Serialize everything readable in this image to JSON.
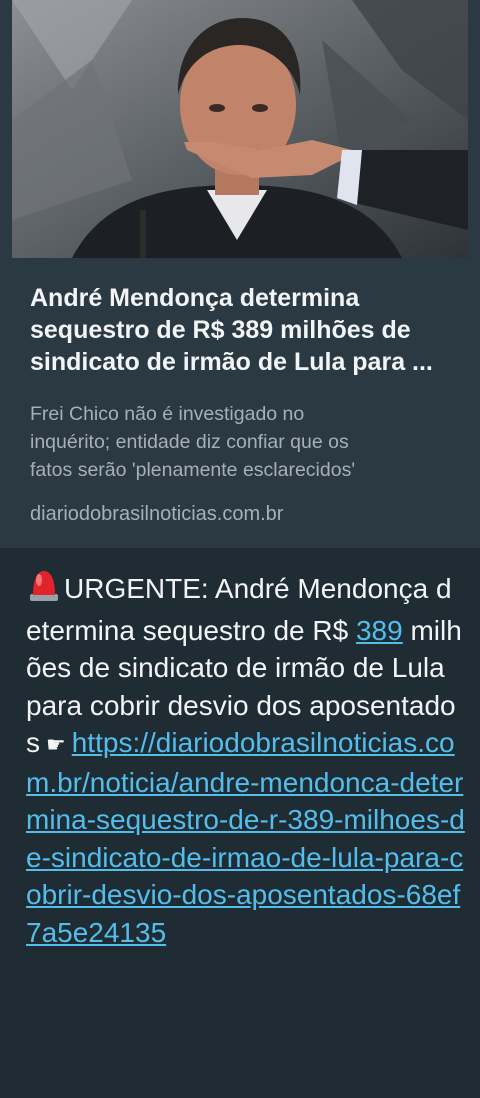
{
  "link_preview": {
    "image_alt": "thumbnail-photo",
    "title_lines": [
      "André Mendonça determina",
      "sequestro de R$ 389 milhões de",
      "sindicato de irmão de Lula para ..."
    ],
    "description_lines": [
      "Frei Chico não é investigado no",
      "inquérito; entidade diz confiar que os",
      "fatos serão 'plenamente esclarecidos'"
    ],
    "domain": "diariodobrasilnoticias.com.br"
  },
  "message": {
    "siren_icon": "police-siren-emoji",
    "text_a": "URGENTE: André Mendonça determina sequestro de R$ ",
    "number": "389",
    "text_b": " milhões de sindicato de irmão de Lula para cobrir desvio dos aposentados",
    "pointer_icon": "pointing-hand-emoji",
    "pointer_glyph": "☛",
    "link": "https://diariodobrasilnoticias.com.br/noticia/andre-mendonca-determina-sequestro-de-r-389-milhoes-de-sindicato-de-irmao-de-lula-para-cobrir-desvio-dos-aposentados-68ef7a5e24135"
  },
  "colors": {
    "bubble": "#1f2c34",
    "preview_bg": "#2a3942",
    "link": "#53bdeb",
    "text": "#f2f4f5",
    "muted": "#a7b0b5"
  }
}
